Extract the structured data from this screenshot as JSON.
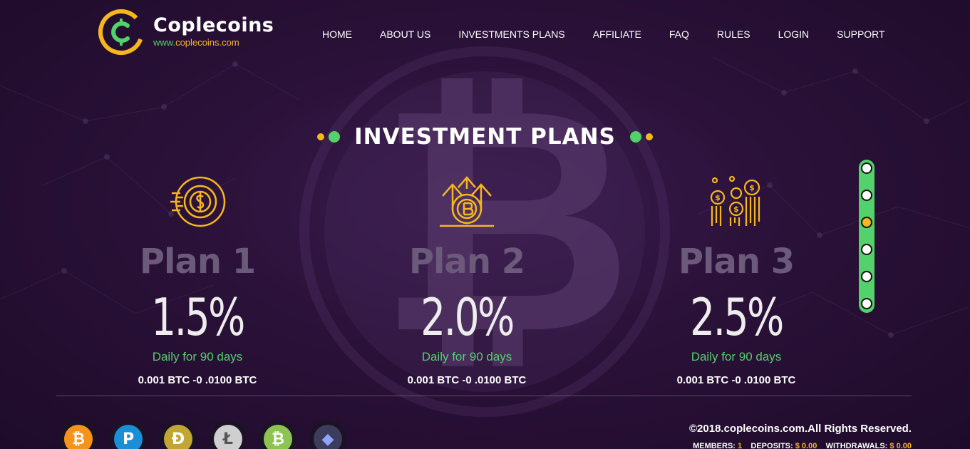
{
  "brand": {
    "name": "Coplecoins",
    "url_www": "www.",
    "url_domain": "coplecoins.com"
  },
  "nav": [
    "HOME",
    "ABOUT US",
    "INVESTMENTS PLANS",
    "AFFILIATE",
    "FAQ",
    "RULES",
    "LOGIN",
    "SUPPORT"
  ],
  "section_title": "INVESTMENT PLANS",
  "plans": [
    {
      "name": "Plan 1",
      "rate": "1.5%",
      "term": "Daily for 90 days",
      "range": "0.001 BTC -0 .0100 BTC",
      "icon": "coin-speed-icon"
    },
    {
      "name": "Plan 2",
      "rate": "2.0%",
      "term": "Daily for 90 days",
      "range": "0.001 BTC -0 .0100 BTC",
      "icon": "bitcoin-growth-icon"
    },
    {
      "name": "Plan 3",
      "rate": "2.5%",
      "term": "Daily for 90 days",
      "range": "0.001 BTC -0 .0100 BTC",
      "icon": "coin-stacks-icon"
    }
  ],
  "slider": {
    "count": 6,
    "active_index": 2
  },
  "coins": [
    {
      "name": "bitcoin-icon",
      "glyph": "₿",
      "color": "#f7931a"
    },
    {
      "name": "payeer-icon",
      "glyph": "P",
      "color": "#1b8fd6"
    },
    {
      "name": "dogecoin-icon",
      "glyph": "Ð",
      "color": "#c2a633"
    },
    {
      "name": "litecoin-icon",
      "glyph": "Ł",
      "color": "#9a9a9a"
    },
    {
      "name": "bitcoin-cash-icon",
      "glyph": "₿",
      "color": "#8dc351"
    },
    {
      "name": "ethereum-icon",
      "glyph": "◆",
      "color": "#3c3c5d"
    }
  ],
  "footer": {
    "copyright": "©2018.coplecoins.com.All Rights Reserved.",
    "members_label": "MEMBERS:",
    "members_value": "1",
    "deposits_label": "DEPOSITS:",
    "deposits_value": "$ 0.00",
    "withdrawals_label": "WITHDRAWALS:",
    "withdrawals_value": "$ 0.00"
  },
  "colors": {
    "accent_green": "#53d16a",
    "accent_yellow": "#f5b71c",
    "background": "#2a1138"
  }
}
